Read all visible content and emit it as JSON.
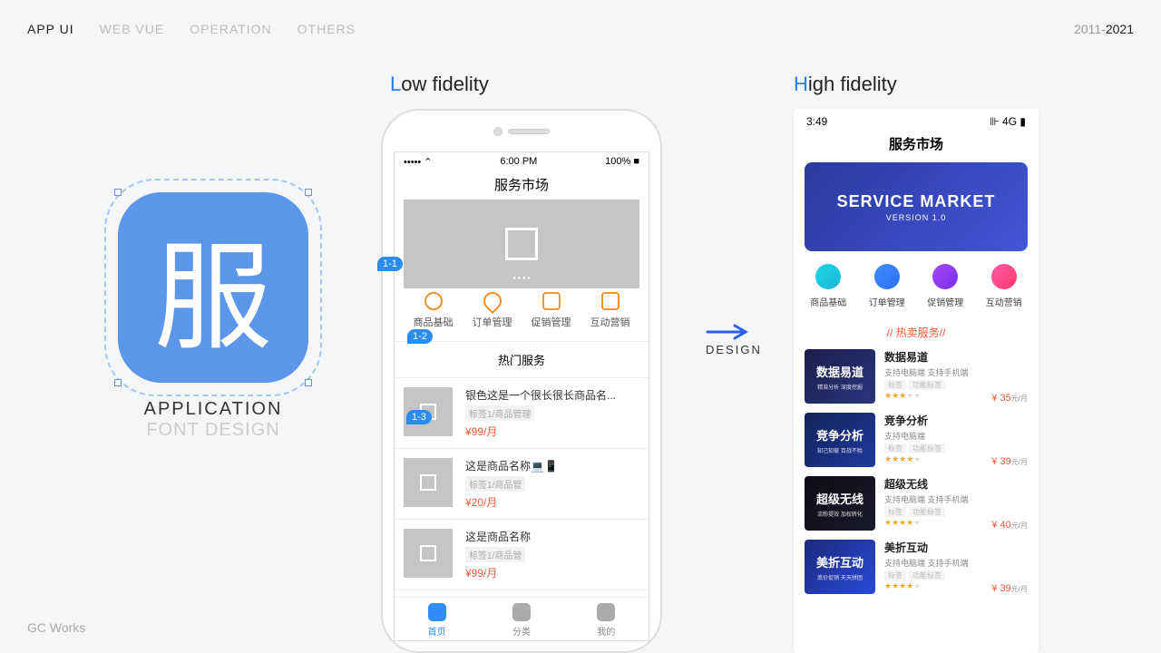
{
  "nav": {
    "items": [
      "APP UI",
      "WEB VUE",
      "OPERATION",
      "OTHERS"
    ]
  },
  "year": {
    "start": "2011-",
    "end": "2021"
  },
  "footer": {
    "a": "GC",
    "b": " Works"
  },
  "appIcon": {
    "char": "服",
    "line1": "APPLICATION",
    "line2": "FONT DESIGN"
  },
  "titles": {
    "lowFirst": "L",
    "lowRest": "ow fidelity",
    "hiFirst": "H",
    "hiRest": "igh fidelity"
  },
  "arrow": {
    "label": "DESIGN"
  },
  "markers": {
    "m1": "1-1",
    "m2": "1-2",
    "m3": "1-3"
  },
  "lofi": {
    "status": {
      "left": "••••• ⌃",
      "time": "6:00 PM",
      "right": "100% ■"
    },
    "title": "服务市场",
    "cats": [
      "商品基础",
      "订单管理",
      "促销管理",
      "互动营销"
    ],
    "section": "热门服务",
    "items": [
      {
        "name": "银色这是一个很长很长商品名...",
        "tag": "标签1/商品管理",
        "price": "¥99/月"
      },
      {
        "name": "这是商品名称💻📱",
        "tag": "标签1/商品管",
        "price": "¥20/月"
      },
      {
        "name": "这是商品名称",
        "tag": "标签1/商品管",
        "price": "¥99/月"
      }
    ],
    "tabs": [
      "首页",
      "分类",
      "我的"
    ]
  },
  "hifi": {
    "status": {
      "time": "3:49",
      "right": "⊪ 4G ▮"
    },
    "title": "服务市场",
    "banner": {
      "t": "SERVICE MARKET",
      "s": "VERSION 1.0"
    },
    "cats": [
      {
        "label": "商品基础",
        "color": "linear-gradient(135deg,#1fd4e6,#1bb8d8)"
      },
      {
        "label": "订单管理",
        "color": "linear-gradient(135deg,#3f8cff,#2d6ef5)"
      },
      {
        "label": "促销管理",
        "color": "linear-gradient(135deg,#a24af5,#7a2df0)"
      },
      {
        "label": "互动营销",
        "color": "linear-gradient(135deg,#ff5aa8,#ff3a6e)"
      }
    ],
    "section": "热卖服务",
    "items": [
      {
        "thumb": "数据易道",
        "sub": "精准分析 深度挖掘",
        "bg": "linear-gradient(135deg,#1a1f4a,#2a3580)",
        "name": "数据易道",
        "support": "支持电脑端   支持手机端",
        "tags": [
          "标签",
          "功能标签"
        ],
        "stars": 3,
        "price": "¥ 35",
        "per": "元/月"
      },
      {
        "thumb": "竞争分析",
        "sub": "知己知彼 百战不殆",
        "bg": "linear-gradient(135deg,#132358,#1e3a9e)",
        "name": "竞争分析",
        "support": "支持电脑端",
        "tags": [
          "标签",
          "功能标签"
        ],
        "stars": 4,
        "price": "¥ 39",
        "per": "元/月"
      },
      {
        "thumb": "超级无线",
        "sub": "流粉提效 加权转化",
        "bg": "linear-gradient(135deg,#0c0c16,#1a1a2e)",
        "name": "超级无线",
        "support": "支持电脑端   支持手机端",
        "tags": [
          "标签",
          "功能标签"
        ],
        "stars": 4,
        "price": "¥ 40",
        "per": "元/月"
      },
      {
        "thumb": "美折互动",
        "sub": "底价促销 天天拼团",
        "bg": "linear-gradient(135deg,#1a2a7e,#2a4ad8)",
        "name": "美折互动",
        "support": "支持电脑端   支持手机端",
        "tags": [
          "标签",
          "功能标签"
        ],
        "stars": 4,
        "price": "¥ 39",
        "per": "元/月"
      }
    ]
  }
}
